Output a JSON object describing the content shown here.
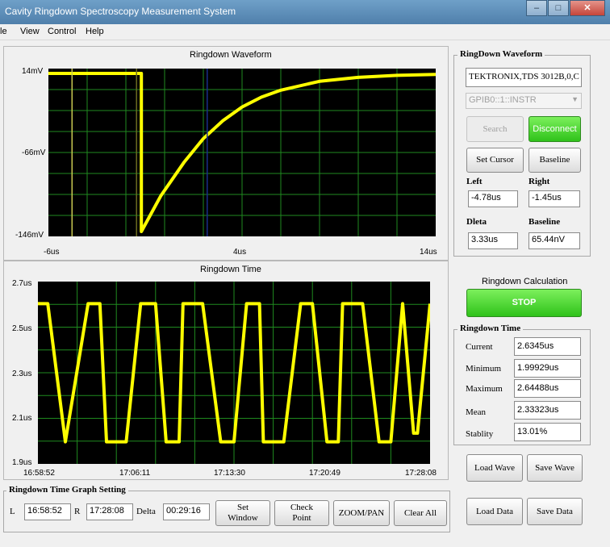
{
  "window": {
    "title": "Cavity Ringdown Spectroscopy Measurement System"
  },
  "menu": [
    "le",
    "View",
    "Control",
    "Help"
  ],
  "waveform_plot": {
    "title": "Ringdown Waveform",
    "y_ticks": [
      "14mV",
      "-66mV",
      "-146mV"
    ],
    "x_ticks": [
      "-6us",
      "4us",
      "14us"
    ]
  },
  "time_plot": {
    "title": "Ringdown Time",
    "y_ticks": [
      "2.7us",
      "2.5us",
      "2.3us",
      "2.1us",
      "1.9us"
    ],
    "x_ticks": [
      "16:58:52",
      "17:06:11",
      "17:13:30",
      "17:20:49",
      "17:28:08"
    ]
  },
  "chart_data": [
    {
      "type": "line",
      "title": "Ringdown Waveform",
      "xlabel": "",
      "ylabel": "",
      "xlim": [
        -6,
        14
      ],
      "ylim": [
        -146,
        14
      ],
      "x_unit": "us",
      "y_unit": "mV",
      "grid": true,
      "series": [
        {
          "x": [
            -6,
            -1.2,
            -1.2,
            -0.2,
            1,
            2,
            3,
            4,
            5,
            6,
            8,
            10,
            12,
            14
          ],
          "values": [
            14,
            14,
            -146,
            -110,
            -76,
            -52,
            -34,
            -20,
            -10,
            -3,
            6,
            10,
            12,
            13
          ]
        }
      ],
      "cursors": [
        -4.78,
        -1.45,
        2.2
      ]
    },
    {
      "type": "line",
      "title": "Ringdown Time",
      "xlabel": "",
      "ylabel": "",
      "x_range": [
        "16:58:52",
        "17:28:08"
      ],
      "ylim": [
        1.9,
        2.7
      ],
      "y_unit": "us",
      "grid": true,
      "series": [
        {
          "x": [
            0,
            0.025,
            0.07,
            0.128,
            0.158,
            0.175,
            0.225,
            0.262,
            0.3,
            0.327,
            0.36,
            0.37,
            0.42,
            0.466,
            0.5,
            0.532,
            0.565,
            0.575,
            0.627,
            0.67,
            0.7,
            0.737,
            0.766,
            0.777,
            0.828,
            0.87,
            0.9,
            0.93,
            0.958,
            0.968,
            1.0
          ],
          "values": [
            2.62,
            2.62,
            1.98,
            2.62,
            2.62,
            1.98,
            1.98,
            2.62,
            2.62,
            1.98,
            1.98,
            2.62,
            2.62,
            1.98,
            1.98,
            2.62,
            2.62,
            1.98,
            1.98,
            2.62,
            2.62,
            1.98,
            1.98,
            2.62,
            2.62,
            1.98,
            1.98,
            2.62,
            2.02,
            2.02,
            2.62
          ]
        }
      ]
    }
  ],
  "ringdown_waveform_group": {
    "title": "RingDown Waveform",
    "instrument": "TEKTRONIX,TDS 3012B,0,C",
    "resource": "GPIB0::1::INSTR",
    "search_label": "Search",
    "disconnect_label": "Disconnect",
    "set_cursor_label": "Set Cursor",
    "baseline_button_label": "Baseline",
    "left_label": "Left",
    "left_value": "-4.78us",
    "right_label": "Right",
    "right_value": "-1.45us",
    "delta_label": "Dleta",
    "delta_value": "3.33us",
    "baseline_label": "Baseline",
    "baseline_value": "65.44nV"
  },
  "calculation": {
    "title": "Ringdown Calculation",
    "stop_label": "STOP"
  },
  "ringdown_time_group": {
    "title": "Ringdown Time",
    "rows": [
      {
        "label": "Current",
        "value": "2.6345us"
      },
      {
        "label": "Minimum",
        "value": "1.99929us"
      },
      {
        "label": "Maximum",
        "value": "2.64488us"
      },
      {
        "label": "Mean",
        "value": "2.33323us"
      },
      {
        "label": "Stablity",
        "value": "13.01%"
      }
    ]
  },
  "files": {
    "load_wave": "Load Wave",
    "save_wave": "Save Wave",
    "load_data": "Load Data",
    "save_data": "Save Data"
  },
  "graph_setting": {
    "title": "Ringdown Time Graph Setting",
    "l_label": "L",
    "l_value": "16:58:52",
    "r_label": "R",
    "r_value": "17:28:08",
    "delta_label": "Delta",
    "delta_value": "00:29:16",
    "set_window": "Set Window",
    "check_point": "Check Point",
    "zoom_pan": "ZOOM/PAN",
    "clear_all": "Clear All"
  },
  "colors": {
    "trace": "#ffff00",
    "grid": "#1f8a1f",
    "plot_bg": "#000000",
    "green_button": "#2fc21a"
  }
}
